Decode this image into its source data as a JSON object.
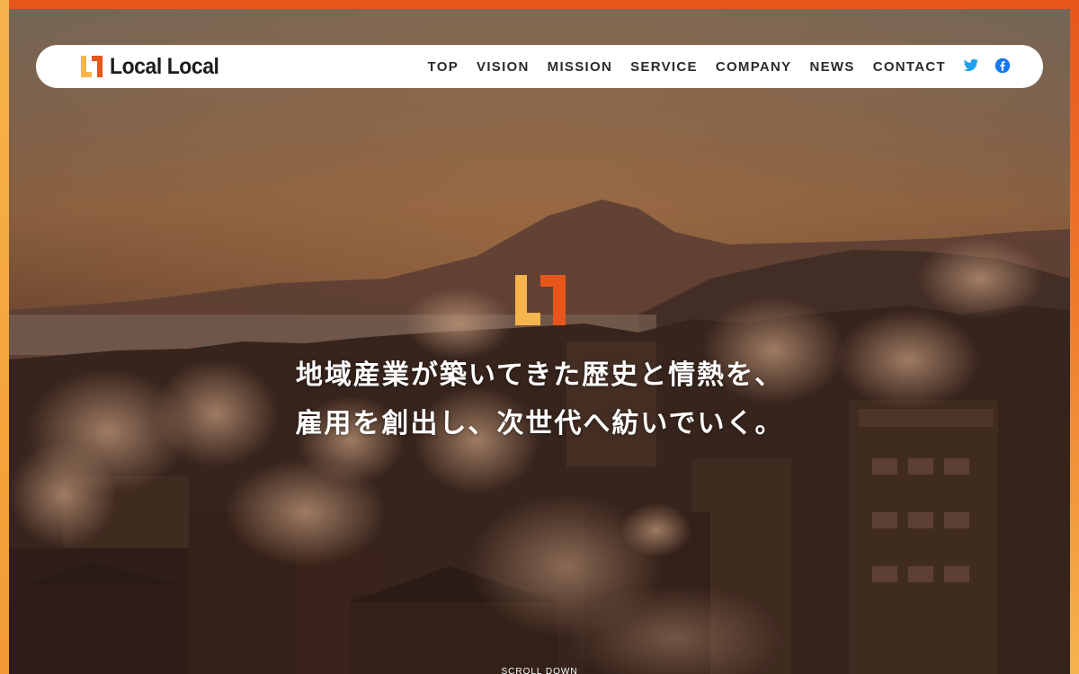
{
  "nav": {
    "logo_text": "Local Local",
    "items": [
      {
        "label": "TOP"
      },
      {
        "label": "VISION"
      },
      {
        "label": "MISSION"
      },
      {
        "label": "SERVICE"
      },
      {
        "label": "COMPANY"
      },
      {
        "label": "NEWS"
      },
      {
        "label": "CONTACT"
      }
    ],
    "social": [
      {
        "icon": "twitter-icon",
        "color": "#1da1f2"
      },
      {
        "icon": "facebook-icon",
        "color": "#1877f2"
      }
    ]
  },
  "hero": {
    "line1": "地域産業が築いてきた歴史と情熱を、",
    "line2": "雇用を創出し、次世代へ紡いでいく。",
    "scroll_label": "SCROLL DOWN"
  },
  "colors": {
    "brand_orange": "#e8561c",
    "brand_yellow": "#f6b44c"
  }
}
